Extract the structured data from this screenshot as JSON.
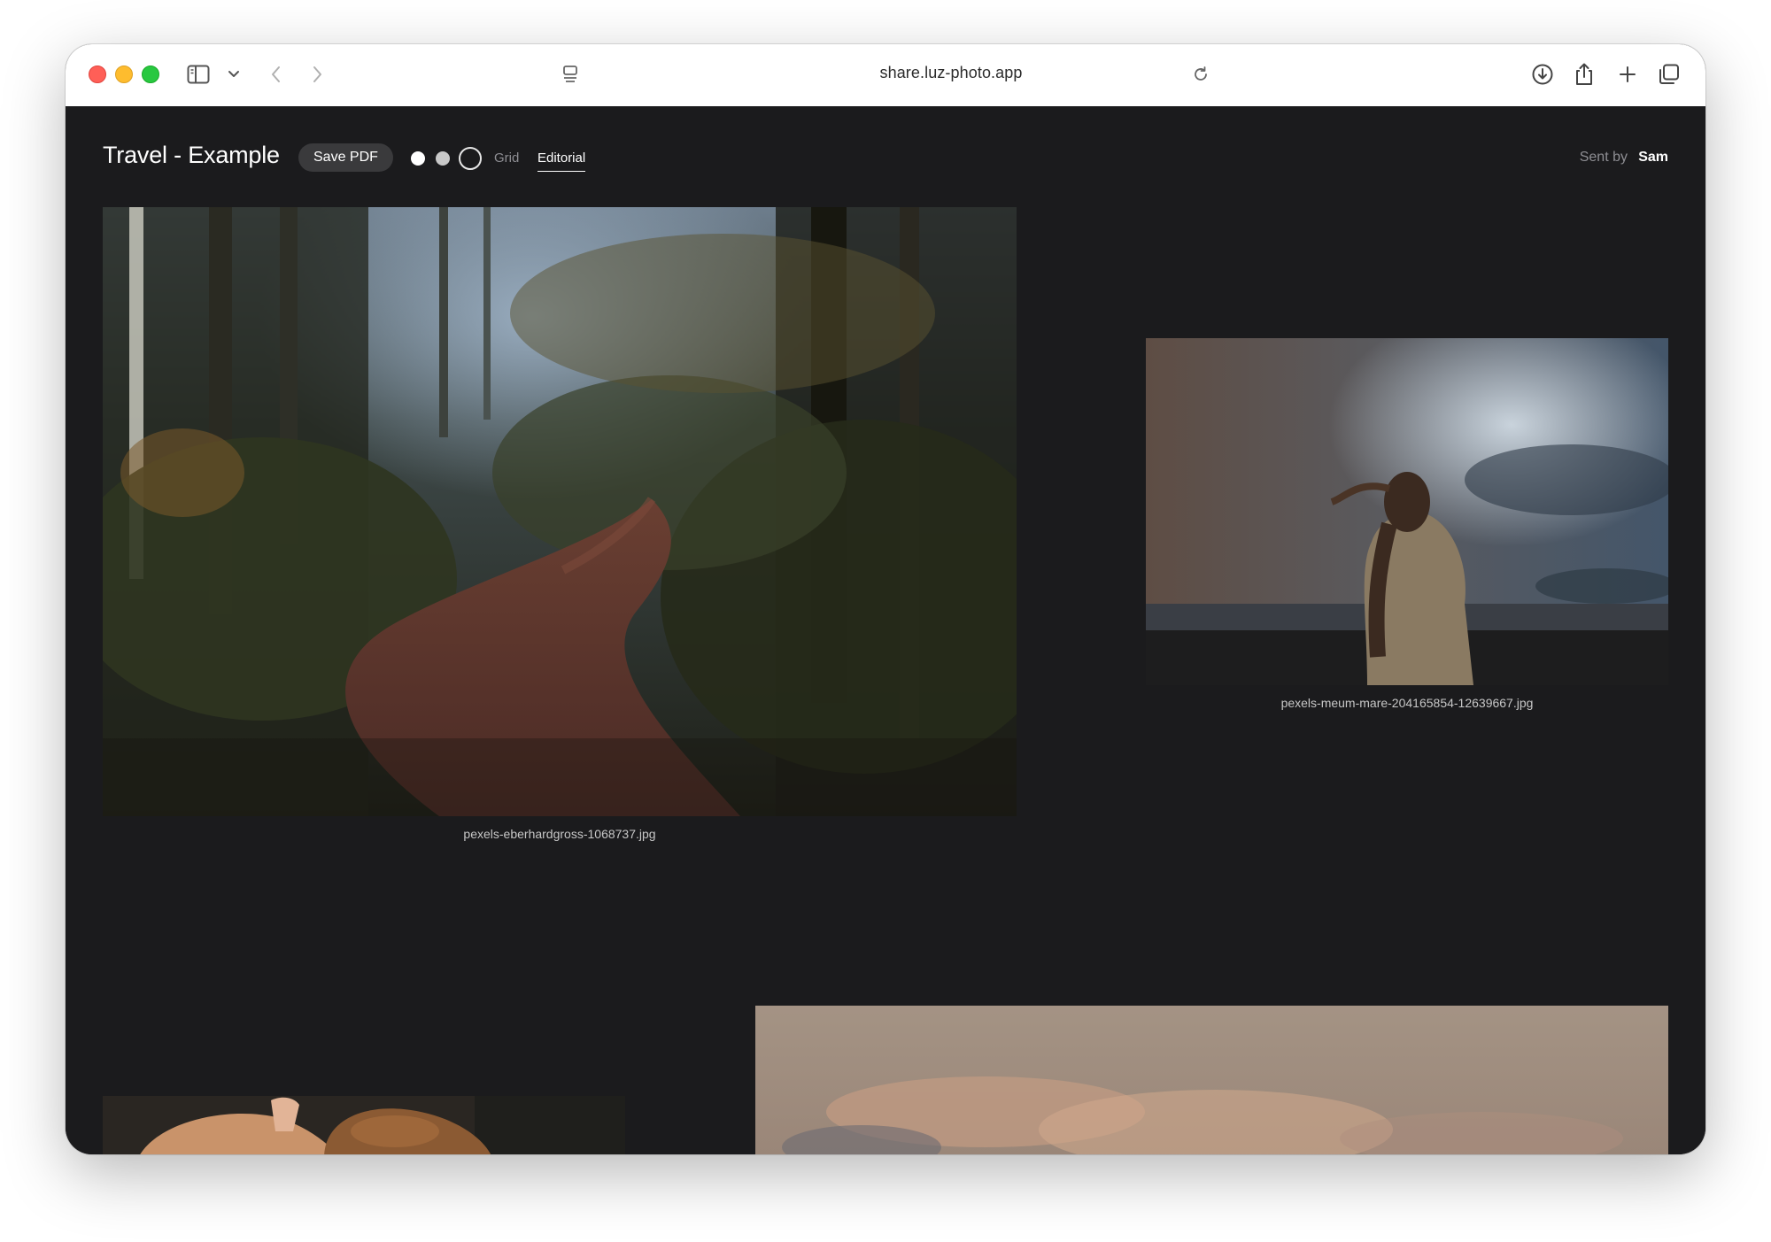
{
  "browser": {
    "url": "share.luz-photo.app",
    "icons": {
      "sidebar": "sidebar-icon",
      "dropdown": "chevron-down-icon",
      "back": "chevron-left-icon",
      "forward": "chevron-right-icon",
      "reader": "reader-icon",
      "reload": "reload-icon",
      "download": "download-icon",
      "share": "share-icon",
      "new_tab": "plus-icon",
      "tabs": "tabs-overview-icon"
    }
  },
  "header": {
    "title": "Travel - Example",
    "save_pdf_label": "Save PDF",
    "background_options": [
      "white",
      "grey",
      "dark"
    ],
    "view_tabs": [
      {
        "label": "Grid",
        "active": false
      },
      {
        "label": "Editorial",
        "active": true
      }
    ],
    "sent_by_label": "Sent by",
    "sender_name": "Sam"
  },
  "photos": [
    {
      "caption": "pexels-eberhardgross-1068737.jpg",
      "subject": "forest path with autumn leaves"
    },
    {
      "caption": "pexels-meum-mare-204165854-12639667.jpg",
      "subject": "woman by the sea under stormy sky"
    },
    {
      "caption": "",
      "subject": "hands holding bread (partially visible)"
    },
    {
      "caption": "",
      "subject": "warm hazy sky with clouds (partially visible)"
    }
  ],
  "colors": {
    "page_background": "#1b1b1d",
    "button_background": "#3a3a3c",
    "muted_text": "#8e8e93",
    "primary_text": "#ffffff"
  }
}
